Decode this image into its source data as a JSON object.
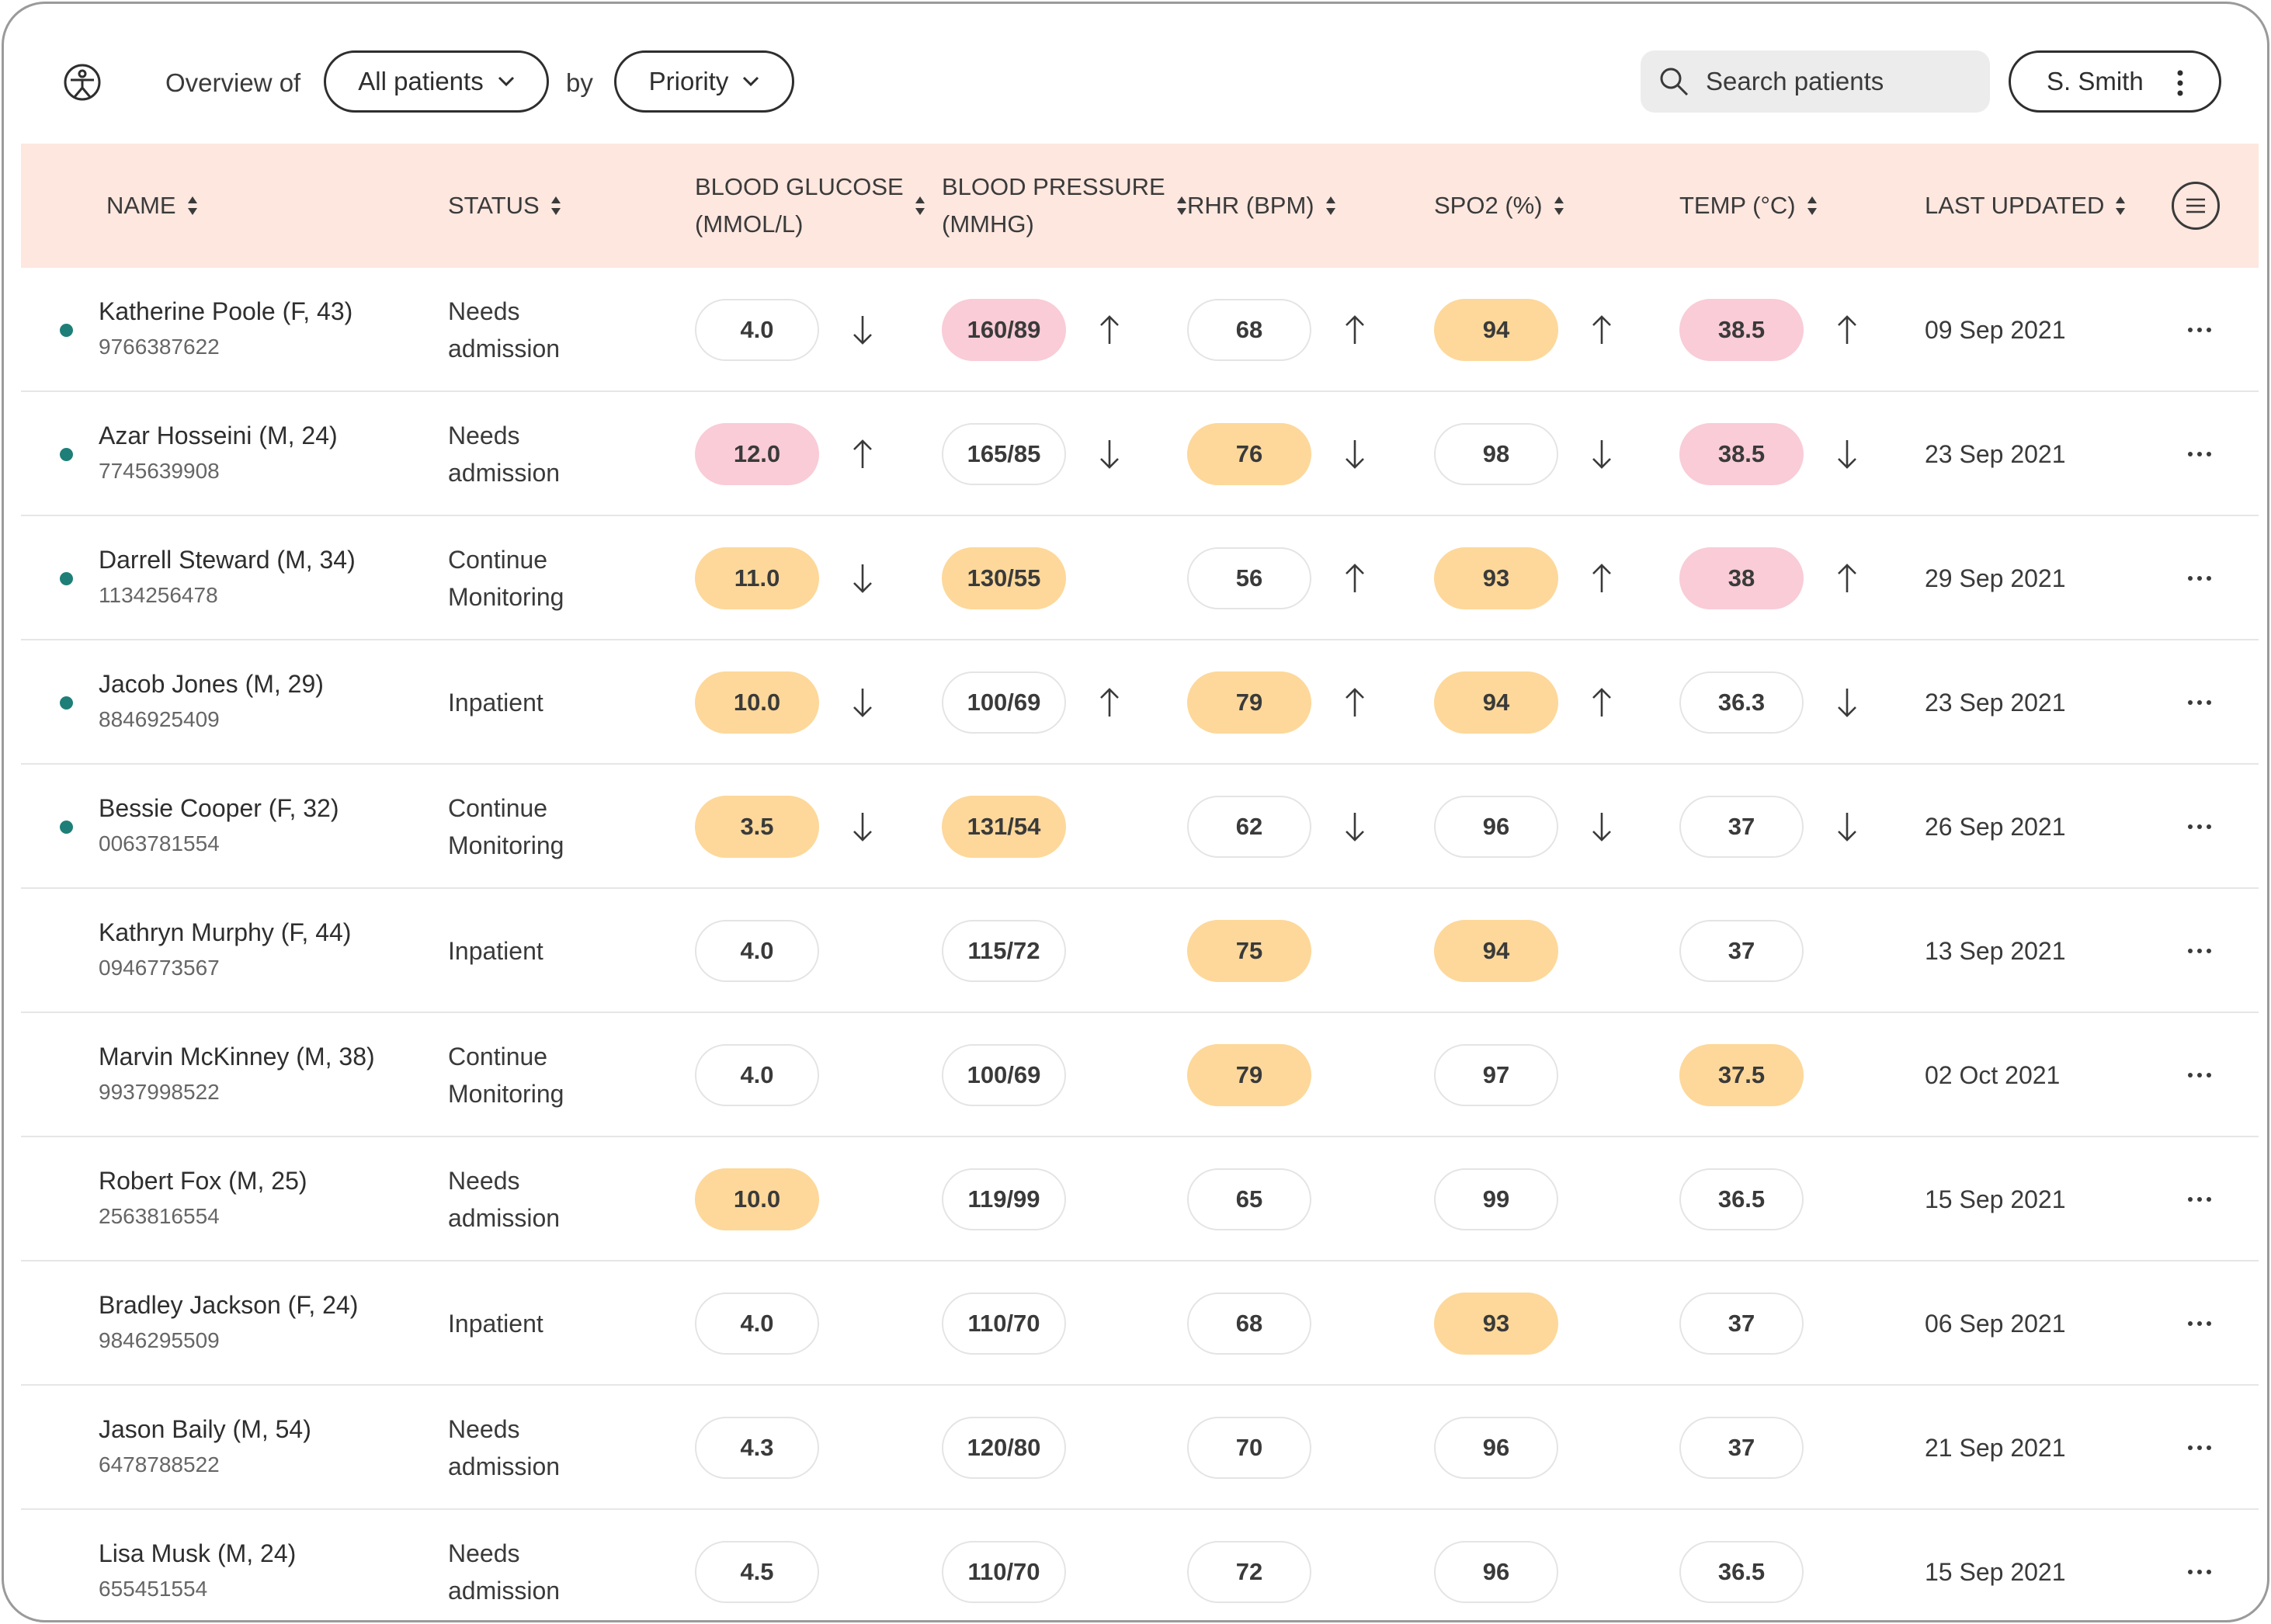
{
  "app": {
    "logo_icon": "stethoscope-person-icon"
  },
  "toolbar": {
    "overview_label": "Overview of",
    "patients_filter": "All patients",
    "by_label": "by",
    "sort_filter": "Priority",
    "search_placeholder": "Search patients",
    "user_name": "S. Smith"
  },
  "columns": {
    "name": "NAME",
    "status": "STATUS",
    "glucose_line1": "BLOOD GLUCOSE",
    "glucose_line2": "(MMOL/L)",
    "pressure_line1": "BLOOD PRESSURE",
    "pressure_line2": "(MMHG)",
    "rhr": "RHR (BPM)",
    "spo2": "SPO2 (%)",
    "temp": "TEMP (°C)",
    "updated": "LAST UPDATED"
  },
  "colors": {
    "header_bg": "#fde7df",
    "warn": "#fdd89a",
    "alert": "#f9ccd7",
    "active_dot": "#1e7f78"
  },
  "patients": [
    {
      "name": "Katherine Poole (F, 43)",
      "id": "9766387622",
      "active": true,
      "status": [
        "Needs",
        "admission"
      ],
      "glucose": {
        "v": "4.0",
        "lvl": "normal",
        "trend": "down"
      },
      "bp": {
        "v": "160/89",
        "lvl": "alert",
        "trend": "up"
      },
      "rhr": {
        "v": "68",
        "lvl": "normal",
        "trend": "up"
      },
      "spo2": {
        "v": "94",
        "lvl": "warn",
        "trend": "up"
      },
      "temp": {
        "v": "38.5",
        "lvl": "alert",
        "trend": "up"
      },
      "updated": "09 Sep 2021"
    },
    {
      "name": "Azar Hosseini (M, 24)",
      "id": "7745639908",
      "active": true,
      "status": [
        "Needs",
        "admission"
      ],
      "glucose": {
        "v": "12.0",
        "lvl": "alert",
        "trend": "up"
      },
      "bp": {
        "v": "165/85",
        "lvl": "normal",
        "trend": "down"
      },
      "rhr": {
        "v": "76",
        "lvl": "warn",
        "trend": "down"
      },
      "spo2": {
        "v": "98",
        "lvl": "normal",
        "trend": "down"
      },
      "temp": {
        "v": "38.5",
        "lvl": "alert",
        "trend": "down"
      },
      "updated": "23 Sep 2021"
    },
    {
      "name": "Darrell Steward (M, 34)",
      "id": "1134256478",
      "active": true,
      "status": [
        "Continue",
        "Monitoring"
      ],
      "glucose": {
        "v": "11.0",
        "lvl": "warn",
        "trend": "down"
      },
      "bp": {
        "v": "130/55",
        "lvl": "warn",
        "trend": ""
      },
      "rhr": {
        "v": "56",
        "lvl": "normal",
        "trend": "up"
      },
      "spo2": {
        "v": "93",
        "lvl": "warn",
        "trend": "up"
      },
      "temp": {
        "v": "38",
        "lvl": "alert",
        "trend": "up"
      },
      "updated": "29 Sep 2021"
    },
    {
      "name": "Jacob Jones (M, 29)",
      "id": "8846925409",
      "active": true,
      "status": [
        "Inpatient"
      ],
      "glucose": {
        "v": "10.0",
        "lvl": "warn",
        "trend": "down"
      },
      "bp": {
        "v": "100/69",
        "lvl": "normal",
        "trend": "up"
      },
      "rhr": {
        "v": "79",
        "lvl": "warn",
        "trend": "up"
      },
      "spo2": {
        "v": "94",
        "lvl": "warn",
        "trend": "up"
      },
      "temp": {
        "v": "36.3",
        "lvl": "normal",
        "trend": "down"
      },
      "updated": "23 Sep 2021"
    },
    {
      "name": "Bessie Cooper (F, 32)",
      "id": "0063781554",
      "active": true,
      "status": [
        "Continue",
        "Monitoring"
      ],
      "glucose": {
        "v": "3.5",
        "lvl": "warn",
        "trend": "down"
      },
      "bp": {
        "v": "131/54",
        "lvl": "warn",
        "trend": ""
      },
      "rhr": {
        "v": "62",
        "lvl": "normal",
        "trend": "down"
      },
      "spo2": {
        "v": "96",
        "lvl": "normal",
        "trend": "down"
      },
      "temp": {
        "v": "37",
        "lvl": "normal",
        "trend": "down"
      },
      "updated": "26 Sep 2021"
    },
    {
      "name": "Kathryn Murphy (F, 44)",
      "id": "0946773567",
      "active": false,
      "status": [
        "Inpatient"
      ],
      "glucose": {
        "v": "4.0",
        "lvl": "normal",
        "trend": ""
      },
      "bp": {
        "v": "115/72",
        "lvl": "normal",
        "trend": ""
      },
      "rhr": {
        "v": "75",
        "lvl": "warn",
        "trend": ""
      },
      "spo2": {
        "v": "94",
        "lvl": "warn",
        "trend": ""
      },
      "temp": {
        "v": "37",
        "lvl": "normal",
        "trend": ""
      },
      "updated": "13 Sep 2021"
    },
    {
      "name": "Marvin McKinney (M, 38)",
      "id": "9937998522",
      "active": false,
      "status": [
        "Continue",
        "Monitoring"
      ],
      "glucose": {
        "v": "4.0",
        "lvl": "normal",
        "trend": ""
      },
      "bp": {
        "v": "100/69",
        "lvl": "normal",
        "trend": ""
      },
      "rhr": {
        "v": "79",
        "lvl": "warn",
        "trend": ""
      },
      "spo2": {
        "v": "97",
        "lvl": "normal",
        "trend": ""
      },
      "temp": {
        "v": "37.5",
        "lvl": "warn",
        "trend": ""
      },
      "updated": "02 Oct 2021"
    },
    {
      "name": "Robert Fox (M, 25)",
      "id": "2563816554",
      "active": false,
      "status": [
        "Needs",
        "admission"
      ],
      "glucose": {
        "v": "10.0",
        "lvl": "warn",
        "trend": ""
      },
      "bp": {
        "v": "119/99",
        "lvl": "normal",
        "trend": ""
      },
      "rhr": {
        "v": "65",
        "lvl": "normal",
        "trend": ""
      },
      "spo2": {
        "v": "99",
        "lvl": "normal",
        "trend": ""
      },
      "temp": {
        "v": "36.5",
        "lvl": "normal",
        "trend": ""
      },
      "updated": "15 Sep 2021"
    },
    {
      "name": "Bradley Jackson (F, 24)",
      "id": "9846295509",
      "active": false,
      "status": [
        "Inpatient"
      ],
      "glucose": {
        "v": "4.0",
        "lvl": "normal",
        "trend": ""
      },
      "bp": {
        "v": "110/70",
        "lvl": "normal",
        "trend": ""
      },
      "rhr": {
        "v": "68",
        "lvl": "normal",
        "trend": ""
      },
      "spo2": {
        "v": "93",
        "lvl": "warn",
        "trend": ""
      },
      "temp": {
        "v": "37",
        "lvl": "normal",
        "trend": ""
      },
      "updated": "06 Sep 2021"
    },
    {
      "name": "Jason Baily (M, 54)",
      "id": "6478788522",
      "active": false,
      "status": [
        "Needs",
        "admission"
      ],
      "glucose": {
        "v": "4.3",
        "lvl": "normal",
        "trend": ""
      },
      "bp": {
        "v": "120/80",
        "lvl": "normal",
        "trend": ""
      },
      "rhr": {
        "v": "70",
        "lvl": "normal",
        "trend": ""
      },
      "spo2": {
        "v": "96",
        "lvl": "normal",
        "trend": ""
      },
      "temp": {
        "v": "37",
        "lvl": "normal",
        "trend": ""
      },
      "updated": "21 Sep 2021"
    },
    {
      "name": "Lisa Musk (M, 24)",
      "id": "655451554",
      "active": false,
      "status": [
        "Needs",
        "admission"
      ],
      "glucose": {
        "v": "4.5",
        "lvl": "normal",
        "trend": ""
      },
      "bp": {
        "v": "110/70",
        "lvl": "normal",
        "trend": ""
      },
      "rhr": {
        "v": "72",
        "lvl": "normal",
        "trend": ""
      },
      "spo2": {
        "v": "96",
        "lvl": "normal",
        "trend": ""
      },
      "temp": {
        "v": "36.5",
        "lvl": "normal",
        "trend": ""
      },
      "updated": "15 Sep 2021"
    }
  ]
}
